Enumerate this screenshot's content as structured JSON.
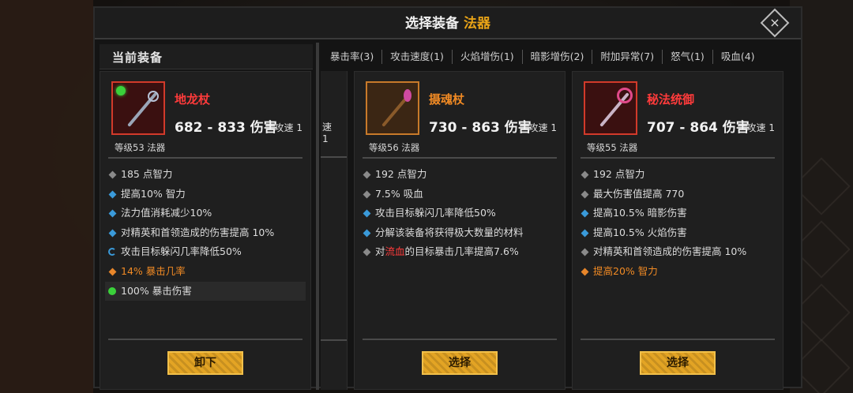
{
  "title": {
    "main": "选择装备",
    "accent": "法器"
  },
  "close_icon": "×",
  "current_header": "当前装备",
  "tabs": [
    "暴击率(3)",
    "攻击速度(1)",
    "火焰增伤(1)",
    "暗影增伤(2)",
    "附加异常(7)",
    "怒气(1)",
    "吸血(4)"
  ],
  "partial_card": {
    "speed": "速 1"
  },
  "cards": [
    {
      "name": "地龙杖",
      "name_color": "red",
      "damage": "682 - 833 伤害",
      "speed": "攻速 1",
      "level": "等级53 法器",
      "stats": [
        {
          "bullet": "grey",
          "text": "185 点智力"
        },
        {
          "bullet": "blue",
          "text": "提高10% 智力"
        },
        {
          "bullet": "blue",
          "text": "法力值消耗减少10%"
        },
        {
          "bullet": "blue",
          "text": "对精英和首领造成的伤害提高 10%"
        },
        {
          "bullet": "refresh",
          "text": "攻击目标躲闪几率降低50%"
        },
        {
          "bullet": "orange",
          "text": "14% 暴击几率"
        },
        {
          "bullet": "green",
          "text": "100% 暴击伤害"
        }
      ],
      "button": "卸下"
    },
    {
      "name": "摄魂杖",
      "name_color": "orange",
      "damage": "730 - 863 伤害",
      "speed": "攻速 1",
      "level": "等级56 法器",
      "stats": [
        {
          "bullet": "grey",
          "text": "192 点智力"
        },
        {
          "bullet": "grey",
          "text": "7.5% 吸血"
        },
        {
          "bullet": "blue",
          "text": "攻击目标躲闪几率降低50%"
        },
        {
          "bullet": "blue",
          "text": "分解该装备将获得极大数量的材料"
        },
        {
          "bullet": "grey",
          "text_pre": "对",
          "text_red": "流血",
          "text_post": "的目标暴击几率提高7.6%"
        }
      ],
      "button": "选择"
    },
    {
      "name": "秘法统御",
      "name_color": "red",
      "damage": "707 - 864 伤害",
      "speed": "攻速 1",
      "level": "等级55 法器",
      "stats": [
        {
          "bullet": "grey",
          "text": "192 点智力"
        },
        {
          "bullet": "grey",
          "text": "最大伤害值提高 770"
        },
        {
          "bullet": "blue",
          "text": "提高10.5% 暗影伤害"
        },
        {
          "bullet": "blue",
          "text": "提高10.5% 火焰伤害"
        },
        {
          "bullet": "grey",
          "text": "对精英和首领造成的伤害提高 10%"
        },
        {
          "bullet": "orange",
          "text": "提高20% 智力"
        }
      ],
      "button": "选择"
    }
  ]
}
